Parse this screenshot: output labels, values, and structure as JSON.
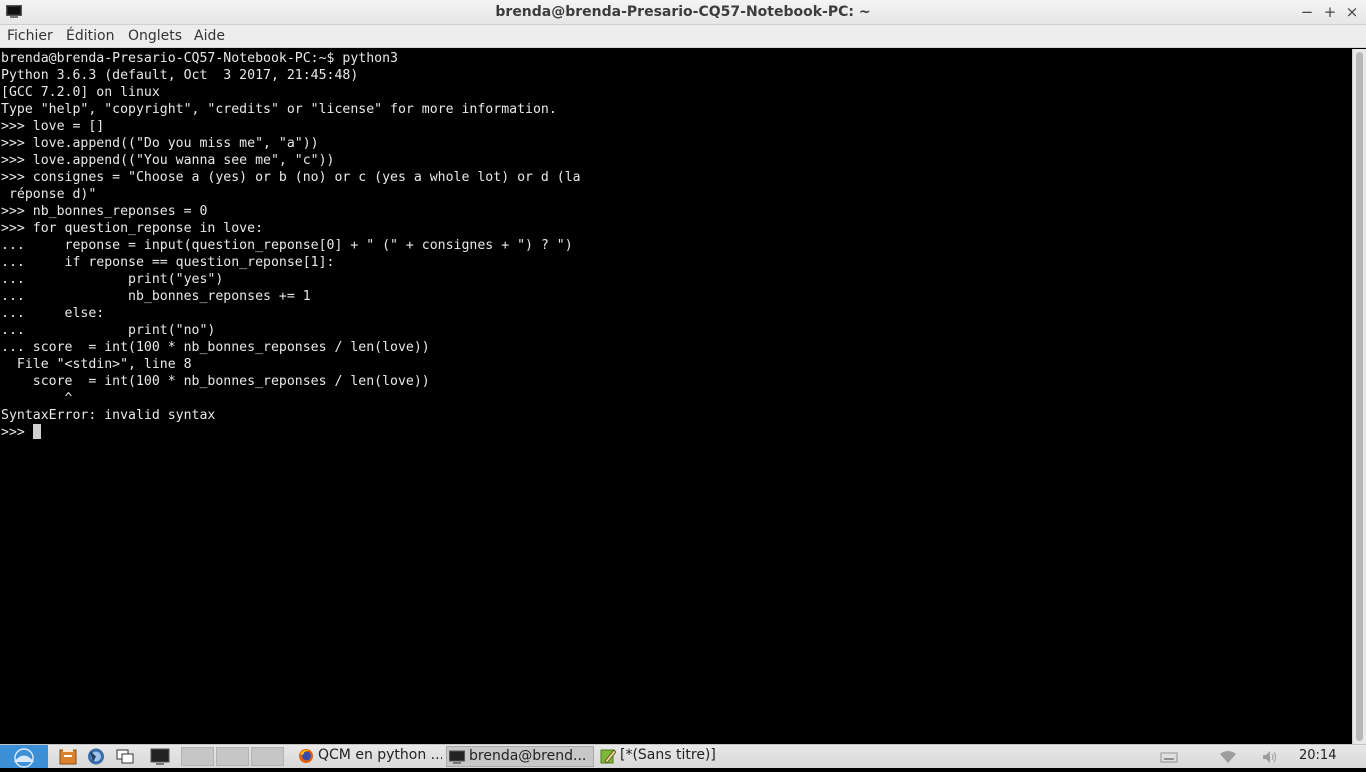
{
  "window": {
    "title": "brenda@brenda-Presario-CQ57-Notebook-PC: ~",
    "minimize_glyph": "−",
    "maximize_glyph": "+",
    "close_glyph": "×",
    "app_icon": "terminal-icon"
  },
  "menu": {
    "items": [
      "Fichier",
      "Édition",
      "Onglets",
      "Aide"
    ]
  },
  "terminal": {
    "lines": [
      "brenda@brenda-Presario-CQ57-Notebook-PC:~$ python3",
      "Python 3.6.3 (default, Oct  3 2017, 21:45:48)",
      "[GCC 7.2.0] on linux",
      "Type \"help\", \"copyright\", \"credits\" or \"license\" for more information.",
      ">>> love = []",
      ">>> love.append((\"Do you miss me\", \"a\"))",
      ">>> love.append((\"You wanna see me\", \"c\"))",
      ">>> consignes = \"Choose a (yes) or b (no) or c (yes a whole lot) or d (la",
      " réponse d)\"",
      ">>> nb_bonnes_reponses = 0",
      ">>> for question_reponse in love:",
      "...     reponse = input(question_reponse[0] + \" (\" + consignes + \") ? \")",
      "...     if reponse == question_reponse[1]:",
      "...             print(\"yes\")",
      "...             nb_bonnes_reponses += 1",
      "...     else:",
      "...             print(\"no\")",
      "... score  = int(100 * nb_bonnes_reponses / len(love))",
      "  File \"<stdin>\", line 8",
      "    score  = int(100 * nb_bonnes_reponses / len(love))",
      "        ^",
      "SyntaxError: invalid syntax"
    ],
    "prompt": ">>> "
  },
  "taskbar": {
    "launchers": [
      "file-manager-icon",
      "browser-icon",
      "windows-icon",
      "terminal-icon"
    ],
    "tasks": [
      {
        "label": "QCM en python ...",
        "icon": "firefox-icon",
        "active": false
      },
      {
        "label": "brenda@brend...",
        "icon": "terminal-icon",
        "active": true
      },
      {
        "label": "[*(Sans titre)]",
        "icon": "text-editor-icon",
        "active": false
      }
    ],
    "tray": [
      "keyboard-icon",
      "wifi-icon",
      "volume-icon"
    ],
    "clock": "20:14"
  }
}
